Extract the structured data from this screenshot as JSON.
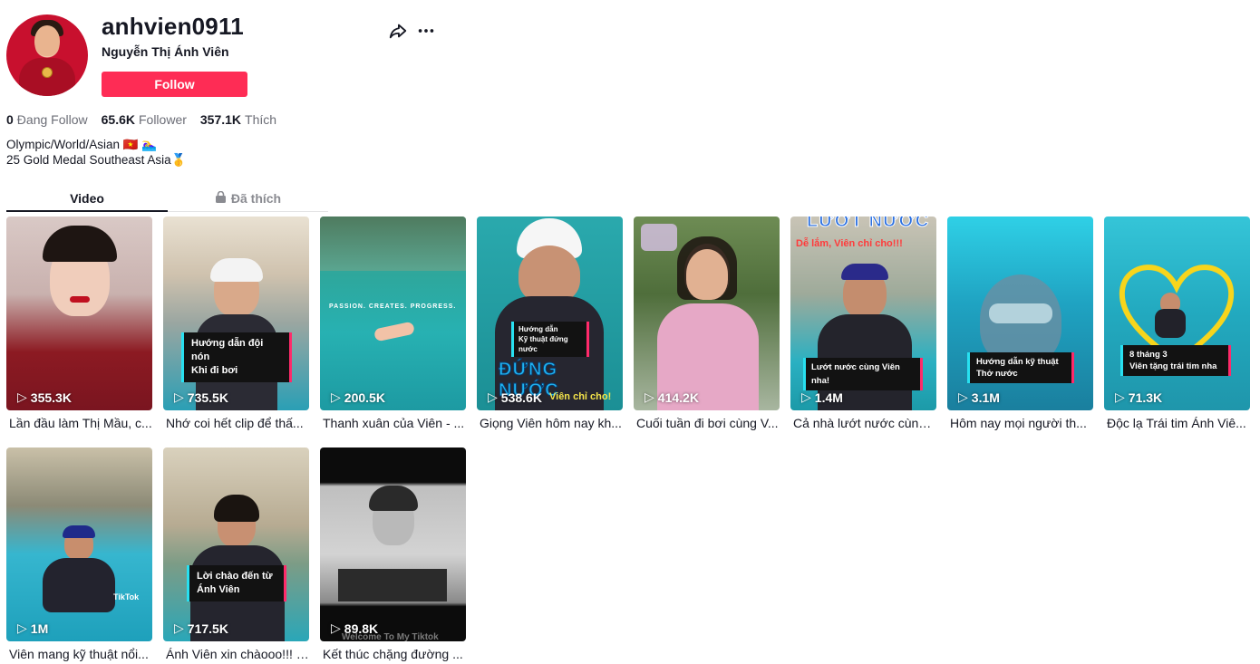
{
  "profile": {
    "username": "anhvien0911",
    "nickname": "Nguyễn Thị Ánh Viên",
    "follow_label": "Follow",
    "stats": [
      {
        "value": "0",
        "label": "Đang Follow"
      },
      {
        "value": "65.6K",
        "label": "Follower"
      },
      {
        "value": "357.1K",
        "label": "Thích"
      }
    ],
    "bio_line1": "Olympic/World/Asian 🇻🇳 🏊‍♀️",
    "bio_line2": "25 Gold Medal Southeast Asia🥇"
  },
  "tabs": [
    {
      "label": "Video"
    },
    {
      "label": "Đã thích"
    }
  ],
  "videos": [
    {
      "views": "355.3K",
      "caption": "Lần đầu làm Thị Mầu, c...",
      "overlay": ""
    },
    {
      "views": "735.5K",
      "caption": "Nhớ coi hết clip để thấ...",
      "overlay_line1": "Hướng dẫn đội nón",
      "overlay_line2": "Khi đi bơi"
    },
    {
      "views": "200.5K",
      "caption": "Thanh xuân của Viên - ...",
      "overlay": "PASSION.  CREATES.  PROGRESS."
    },
    {
      "views": "538.6K",
      "caption": "Giọng Viên hôm nay kh...",
      "overlay_line1": "Hướng dẫn",
      "overlay_line2": "Kỹ thuật đứng nước",
      "big": "ĐỨNG NƯỚC",
      "sub": "Viên chỉ cho!"
    },
    {
      "views": "414.2K",
      "caption": "Cuối tuần đi bơi cùng V...",
      "overlay": ""
    },
    {
      "views": "1.4M",
      "caption": "Cả nhà lướt nước cùng ...",
      "big": "LƯỚT NƯỚC",
      "sub": "Dễ lắm, Viên chỉ cho!!!",
      "overlay_line1": "Lướt nước cùng Viên nha!"
    },
    {
      "views": "3.1M",
      "caption": "Hôm nay mọi người th...",
      "overlay_line1": "Hướng dẫn kỹ thuật",
      "overlay_line2": "Thở nước"
    },
    {
      "views": "71.3K",
      "caption": "Độc lạ Trái tim Ánh Viê...",
      "overlay_line1": "8 tháng 3",
      "overlay_line2": "Viên tặng trái tim nha"
    },
    {
      "views": "1M",
      "caption": "Viên mang kỹ thuật nổi...",
      "overlay": "TikTok"
    },
    {
      "views": "717.5K",
      "caption": "Ánh Viên xin chàooo!!! #Á",
      "overlay_line1": "Lời chào đến từ",
      "overlay_line2": "Ánh Viên"
    },
    {
      "views": "89.8K",
      "caption": "Kết thúc chặng đường ...",
      "overlay": "Welcome To My Tiktok"
    }
  ],
  "colors": {
    "accent": "#fe2c55",
    "text": "#161823",
    "muted": "#6b6d76"
  }
}
